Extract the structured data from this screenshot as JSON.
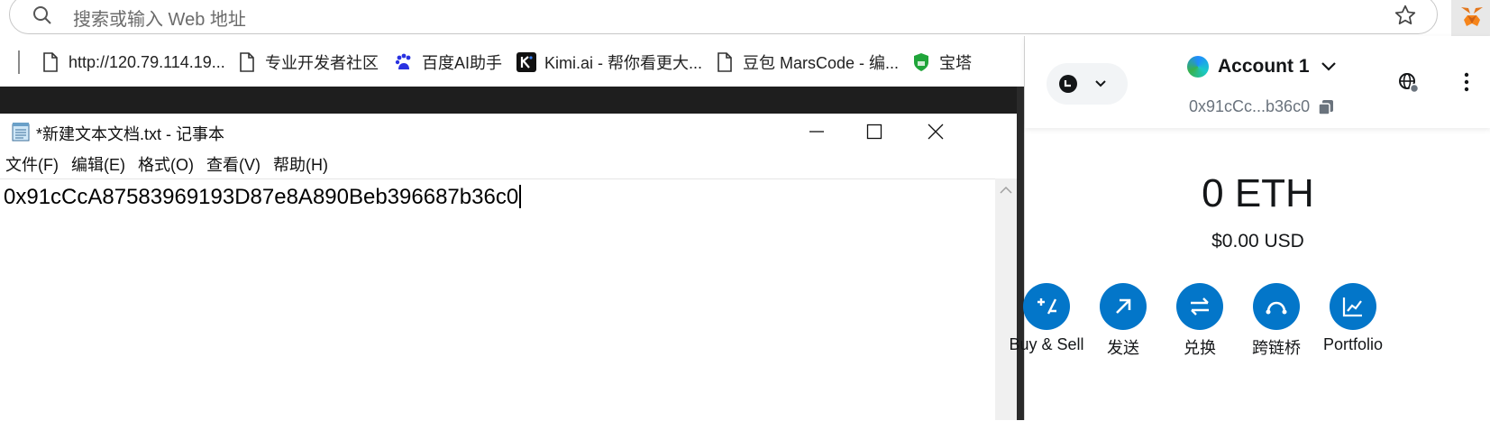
{
  "browser": {
    "omnibox_placeholder": "搜索或输入 Web 地址",
    "bookmarks": [
      {
        "label": "http://120.79.114.19...",
        "icon": "page-icon"
      },
      {
        "label": "专业开发者社区",
        "icon": "page-icon"
      },
      {
        "label": "百度AI助手",
        "icon": "baidu-icon"
      },
      {
        "label": "Kimi.ai - 帮你看更大...",
        "icon": "kimi-icon"
      },
      {
        "label": "豆包 MarsCode - 编...",
        "icon": "page-icon"
      },
      {
        "label": "宝塔",
        "icon": "baota-shield-icon"
      }
    ]
  },
  "notepad": {
    "title": "*新建文本文档.txt - 记事本",
    "menu": [
      "文件(F)",
      "编辑(E)",
      "格式(O)",
      "查看(V)",
      "帮助(H)"
    ],
    "content": "0x91cCcA87583969193D87e8A890Beb396687b36c0"
  },
  "metamask": {
    "account_name": "Account 1",
    "address_short": "0x91cCc...b36c0",
    "balance": "0 ETH",
    "fiat": "$0.00 USD",
    "accent_color": "#0376c9",
    "actions": [
      {
        "label": "Buy & Sell",
        "icon": "buy-sell-icon"
      },
      {
        "label": "发送",
        "icon": "send-arrow-icon"
      },
      {
        "label": "兑换",
        "icon": "swap-icon"
      },
      {
        "label": "跨链桥",
        "icon": "bridge-icon"
      },
      {
        "label": "Portfolio",
        "icon": "portfolio-chart-icon"
      }
    ]
  }
}
